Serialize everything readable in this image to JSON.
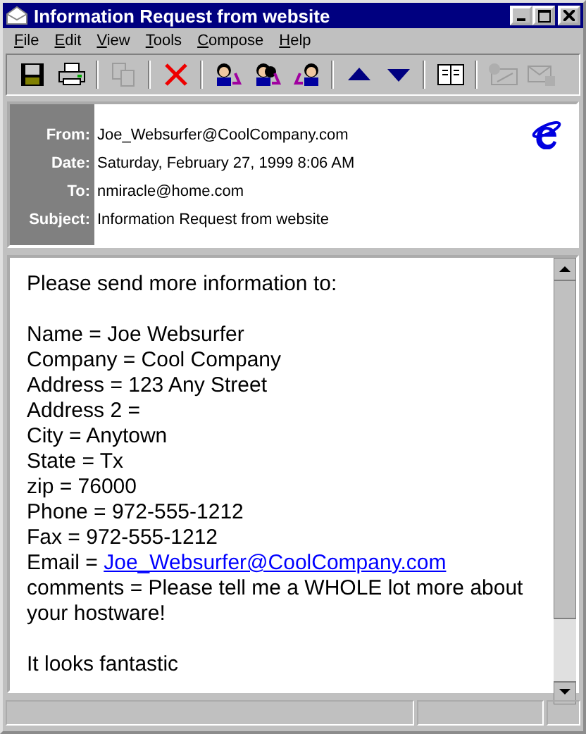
{
  "window": {
    "title": "Information Request from website"
  },
  "menu": [
    "File",
    "Edit",
    "View",
    "Tools",
    "Compose",
    "Help"
  ],
  "toolbar": [
    {
      "kind": "save",
      "disabled": false
    },
    {
      "kind": "print",
      "disabled": false
    },
    {
      "kind": "sep"
    },
    {
      "kind": "copy",
      "disabled": true
    },
    {
      "kind": "sep"
    },
    {
      "kind": "delete",
      "disabled": false
    },
    {
      "kind": "sep"
    },
    {
      "kind": "reply",
      "disabled": false
    },
    {
      "kind": "replyall",
      "disabled": false
    },
    {
      "kind": "forward",
      "disabled": false
    },
    {
      "kind": "sep"
    },
    {
      "kind": "up",
      "disabled": false
    },
    {
      "kind": "down",
      "disabled": false
    },
    {
      "kind": "sep"
    },
    {
      "kind": "addressbook",
      "disabled": false
    },
    {
      "kind": "sep"
    },
    {
      "kind": "sign",
      "disabled": true
    },
    {
      "kind": "encrypt",
      "disabled": true
    }
  ],
  "header": [
    {
      "label": "From:",
      "value": "Joe_Websurfer@CoolCompany.com"
    },
    {
      "label": "Date:",
      "value": "Saturday, February 27, 1999 8:06 AM"
    },
    {
      "label": "To:",
      "value": "nmiracle@home.com"
    },
    {
      "label": "Subject:",
      "value": "Information Request from website"
    }
  ],
  "body": [
    [
      {
        "text": "Please send more information to:"
      }
    ],
    [
      {
        "text": "Name = Joe Websurfer"
      },
      {
        "text": "Company = Cool Company"
      },
      {
        "text": "Address = 123 Any Street"
      },
      {
        "text": "Address 2 ="
      },
      {
        "text": "City = Anytown"
      },
      {
        "text": "State = Tx"
      },
      {
        "text": "zip = 76000"
      },
      {
        "text": "Phone = 972-555-1212"
      },
      {
        "text": "Fax = 972-555-1212"
      },
      {
        "text": "Email = ",
        "link": "Joe_Websurfer@CoolCompany.com"
      },
      {
        "text": "comments = Please tell me a WHOLE lot more about your hostware!"
      }
    ],
    [
      {
        "text": "It looks fantastic"
      }
    ]
  ]
}
